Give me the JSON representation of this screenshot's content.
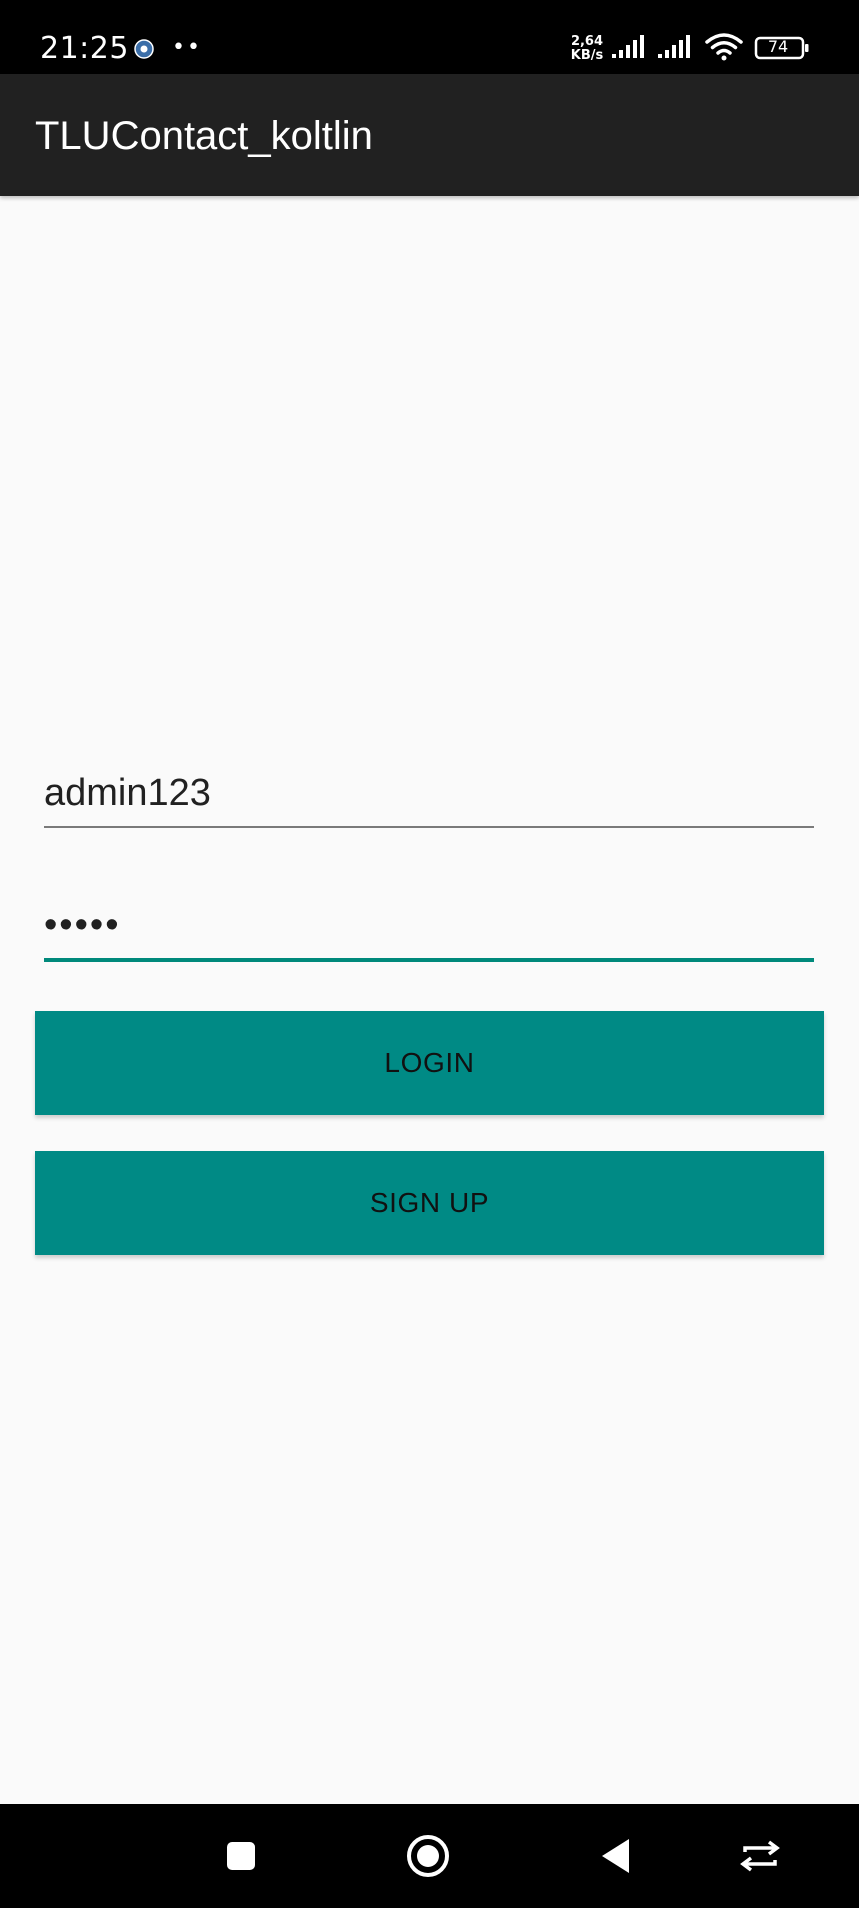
{
  "status_bar": {
    "time": "21:25",
    "notification_dots": "••",
    "net_speed_value": "2,64",
    "net_speed_unit": "KB/s",
    "battery_level": "74",
    "icons": [
      "app-notification-icon",
      "signal-icon",
      "signal-icon",
      "wifi-icon",
      "battery-icon"
    ]
  },
  "app_bar": {
    "title": "TLUContact_koltlin"
  },
  "login_form": {
    "username_value": "admin123",
    "password_value": "•••••"
  },
  "buttons": {
    "login": "LOGIN",
    "signup": "SIGN UP"
  },
  "colors": {
    "app_bar": "#212121",
    "accent": "#008a85",
    "background": "#fafafa"
  },
  "nav_bar": {
    "icons": [
      "recents-icon",
      "home-icon",
      "back-icon",
      "switch-icon"
    ]
  }
}
